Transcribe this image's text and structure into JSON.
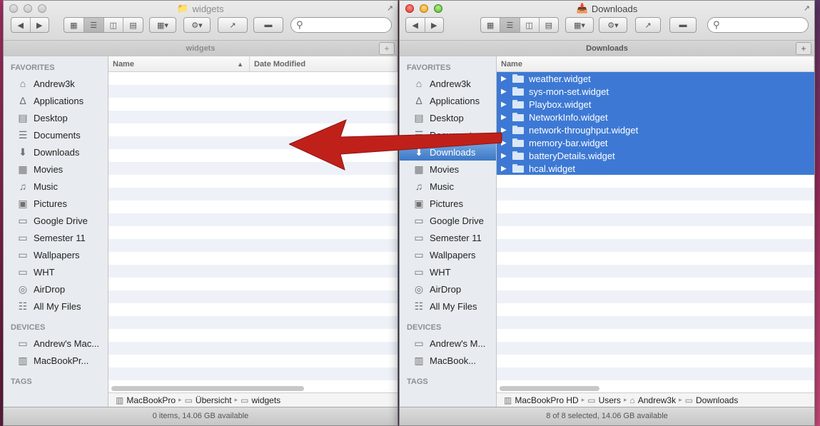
{
  "left_window": {
    "title": "widgets",
    "path_tab": "widgets",
    "sidebar": {
      "favorites_heading": "FAVORITES",
      "favorites": [
        {
          "label": "Andrew3k",
          "icon": "home-icon"
        },
        {
          "label": "Applications",
          "icon": "applications-icon"
        },
        {
          "label": "Desktop",
          "icon": "desktop-icon"
        },
        {
          "label": "Documents",
          "icon": "documents-icon"
        },
        {
          "label": "Downloads",
          "icon": "downloads-icon"
        },
        {
          "label": "Movies",
          "icon": "movies-icon"
        },
        {
          "label": "Music",
          "icon": "music-icon"
        },
        {
          "label": "Pictures",
          "icon": "pictures-icon"
        },
        {
          "label": "Google Drive",
          "icon": "folder-icon"
        },
        {
          "label": "Semester 11",
          "icon": "folder-icon"
        },
        {
          "label": "Wallpapers",
          "icon": "folder-icon"
        },
        {
          "label": "WHT",
          "icon": "folder-icon"
        },
        {
          "label": "AirDrop",
          "icon": "airdrop-icon"
        },
        {
          "label": "All My Files",
          "icon": "all-files-icon"
        }
      ],
      "devices_heading": "DEVICES",
      "devices": [
        {
          "label": "Andrew's Mac...",
          "icon": "computer-icon"
        },
        {
          "label": "MacBookPr...",
          "icon": "disk-icon"
        }
      ],
      "tags_heading": "TAGS"
    },
    "columns": {
      "name": "Name",
      "date_modified": "Date Modified"
    },
    "path_bar": [
      "MacBookPro",
      "Übersicht",
      "widgets"
    ],
    "status": "0 items, 14.06 GB available"
  },
  "right_window": {
    "title": "Downloads",
    "path_tab": "Downloads",
    "sidebar": {
      "favorites_heading": "FAVORITES",
      "favorites": [
        {
          "label": "Andrew3k",
          "icon": "home-icon"
        },
        {
          "label": "Applications",
          "icon": "applications-icon"
        },
        {
          "label": "Desktop",
          "icon": "desktop-icon"
        },
        {
          "label": "Documents",
          "icon": "documents-icon"
        },
        {
          "label": "Downloads",
          "icon": "downloads-icon"
        },
        {
          "label": "Movies",
          "icon": "movies-icon"
        },
        {
          "label": "Music",
          "icon": "music-icon"
        },
        {
          "label": "Pictures",
          "icon": "pictures-icon"
        },
        {
          "label": "Google Drive",
          "icon": "folder-icon"
        },
        {
          "label": "Semester 11",
          "icon": "folder-icon"
        },
        {
          "label": "Wallpapers",
          "icon": "folder-icon"
        },
        {
          "label": "WHT",
          "icon": "folder-icon"
        },
        {
          "label": "AirDrop",
          "icon": "airdrop-icon"
        },
        {
          "label": "All My Files",
          "icon": "all-files-icon"
        }
      ],
      "devices_heading": "DEVICES",
      "devices": [
        {
          "label": "Andrew's M...",
          "icon": "computer-icon"
        },
        {
          "label": "MacBook...",
          "icon": "disk-icon"
        }
      ],
      "tags_heading": "TAGS"
    },
    "columns": {
      "name": "Name"
    },
    "files": [
      "weather.widget",
      "sys-mon-set.widget",
      "Playbox.widget",
      "NetworkInfo.widget",
      "network-throughput.widget",
      "memory-bar.widget",
      "batteryDetails.widget",
      "hcal.widget"
    ],
    "path_bar": [
      "MacBookPro HD",
      "Users",
      "Andrew3k",
      "Downloads"
    ],
    "status": "8 of 8 selected, 14.06 GB available"
  },
  "colors": {
    "selection": "#3d79d4",
    "sidebar_selection": "#3d78c7",
    "arrow": "#c0201a"
  }
}
